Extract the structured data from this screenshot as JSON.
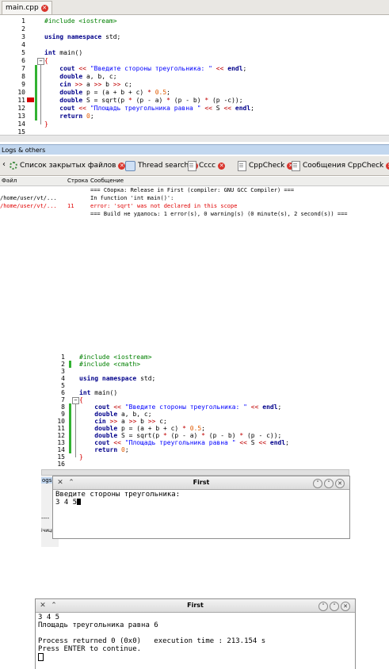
{
  "panel1": {
    "file_tab": "main.cpp",
    "code_lines": [
      {
        "n": "1",
        "html": "<span class=\"pp\">#include &lt;iostream&gt;</span>"
      },
      {
        "n": "2",
        "html": ""
      },
      {
        "n": "3",
        "html": "<span class=\"kw\">using namespace</span> std;"
      },
      {
        "n": "4",
        "html": ""
      },
      {
        "n": "5",
        "html": "<span class=\"kw\">int</span> main()"
      },
      {
        "n": "6",
        "html": "<span class=\"brace\">{</span>"
      },
      {
        "n": "7",
        "html": "    <span class=\"kw\">cout</span> <span class=\"op\">&lt;&lt;</span> <span class=\"str\">\"Введите стороны треугольника: \"</span> <span class=\"op\">&lt;&lt;</span> <span class=\"kw\">endl</span>;"
      },
      {
        "n": "8",
        "html": "    <span class=\"kw\">double</span> a, b, c;"
      },
      {
        "n": "9",
        "html": "    <span class=\"kw\">cin</span> <span class=\"op\">&gt;&gt;</span> a <span class=\"op\">&gt;&gt;</span> b <span class=\"op\">&gt;&gt;</span> c;"
      },
      {
        "n": "10",
        "html": "    <span class=\"kw\">double</span> p = (a + b + c) <span class=\"op\">*</span> <span class=\"num\">0.5</span>;"
      },
      {
        "n": "11",
        "html": "    <span class=\"kw\">double</span> S = sqrt(p <span class=\"op\">*</span> (p - a) <span class=\"op\">*</span> (p - b) <span class=\"op\">*</span> (p -c));"
      },
      {
        "n": "12",
        "html": "    <span class=\"kw\">cout</span> <span class=\"op\">&lt;&lt;</span> <span class=\"str\">\"Площадь треугольника равна \"</span> <span class=\"op\">&lt;&lt;</span> S <span class=\"op\">&lt;&lt;</span> <span class=\"kw\">endl</span>;"
      },
      {
        "n": "13",
        "html": "    <span class=\"kw\">return</span> <span class=\"num\">0</span>;"
      },
      {
        "n": "14",
        "html": "<span class=\"brace\">}</span>"
      },
      {
        "n": "15",
        "html": ""
      }
    ],
    "logs_header": "Logs & others",
    "log_tabs": [
      {
        "label": "Список закрытых файлов",
        "icon": "gear-icon"
      },
      {
        "label": "Thread search",
        "icon": "search-icon"
      },
      {
        "label": "Cccc",
        "icon": "document-icon"
      },
      {
        "label": "CppCheck",
        "icon": "document-icon"
      },
      {
        "label": "Сообщения CppCheck",
        "icon": "document-icon"
      }
    ],
    "col_file": "Файл",
    "col_line": "Строка",
    "col_msg": "Сообщение",
    "log_rows": [
      {
        "file": "",
        "line": "",
        "msg": "=== Сборка: Release in First (compiler: GNU GCC Compiler) ===",
        "color": "#000000"
      },
      {
        "file": "/home/user/vt/...",
        "line": "",
        "msg": "In function 'int main()':",
        "color": "#000000"
      },
      {
        "file": "/home/user/vt/...",
        "line": "11",
        "msg": "error: 'sqrt' was not declared in this scope",
        "color": "#e00000"
      },
      {
        "file": "",
        "line": "",
        "msg": "=== Build не удалось: 1 error(s), 0 warning(s) (0 minute(s), 2 second(s)) ===",
        "color": "#000000"
      }
    ]
  },
  "panel2": {
    "code_lines": [
      {
        "n": "1",
        "html": "<span class=\"pp\">#include &lt;iostream&gt;</span>"
      },
      {
        "n": "2",
        "html": "<span class=\"pp\">#include &lt;cmath&gt;</span>"
      },
      {
        "n": "3",
        "html": ""
      },
      {
        "n": "4",
        "html": "<span class=\"kw\">using namespace</span> std;"
      },
      {
        "n": "5",
        "html": ""
      },
      {
        "n": "6",
        "html": "<span class=\"kw\">int</span> main()"
      },
      {
        "n": "7",
        "html": "<span class=\"brace\">{</span>"
      },
      {
        "n": "8",
        "html": "    <span class=\"kw\">cout</span> <span class=\"op\">&lt;&lt;</span> <span class=\"str\">\"Введите стороны треугольника: \"</span> <span class=\"op\">&lt;&lt;</span> <span class=\"kw\">endl</span>;"
      },
      {
        "n": "9",
        "html": "    <span class=\"kw\">double</span> a, b, c;"
      },
      {
        "n": "10",
        "html": "    <span class=\"kw\">cin</span> <span class=\"op\">&gt;&gt;</span> a <span class=\"op\">&gt;&gt;</span> b <span class=\"op\">&gt;&gt;</span> c;"
      },
      {
        "n": "11",
        "html": "    <span class=\"kw\">double</span> p = (a + b + c) <span class=\"op\">*</span> <span class=\"num\">0.5</span>;"
      },
      {
        "n": "12",
        "html": "    <span class=\"kw\">double</span> S = sqrt(p <span class=\"op\">*</span> (p - a) <span class=\"op\">*</span> (p - b) <span class=\"op\">*</span> (p - c));"
      },
      {
        "n": "13",
        "html": "    <span class=\"kw\">cout</span> <span class=\"op\">&lt;&lt;</span> <span class=\"str\">\"Площадь треугольника равна \"</span> <span class=\"op\">&lt;&lt;</span> S <span class=\"op\">&lt;&lt;</span> <span class=\"kw\">endl</span>;"
      },
      {
        "n": "14",
        "html": "    <span class=\"kw\">return</span> <span class=\"num\">0</span>;"
      },
      {
        "n": "15",
        "html": "<span class=\"brace\">}</span>"
      },
      {
        "n": "16",
        "html": ""
      }
    ],
    "under_logs": "ogs",
    "under_dash": "----",
    "under_hint": "ічицк",
    "terminal_title": "First",
    "terminal_line1": "Введите стороны треугольника:",
    "terminal_line2": "3 4 5"
  },
  "panel3": {
    "terminal_title": "First",
    "lines": [
      "3 4 5",
      "Площадь треугольника равна 6",
      "",
      "Process returned 0 (0x0)   execution time : 213.154 s",
      "Press ENTER to continue."
    ]
  },
  "colors": {
    "keyword": "#00008b",
    "preprocessor": "#008000",
    "string": "#0000ff",
    "number": "#e05a00",
    "error": "#e00000",
    "changebar": "#32b232"
  }
}
